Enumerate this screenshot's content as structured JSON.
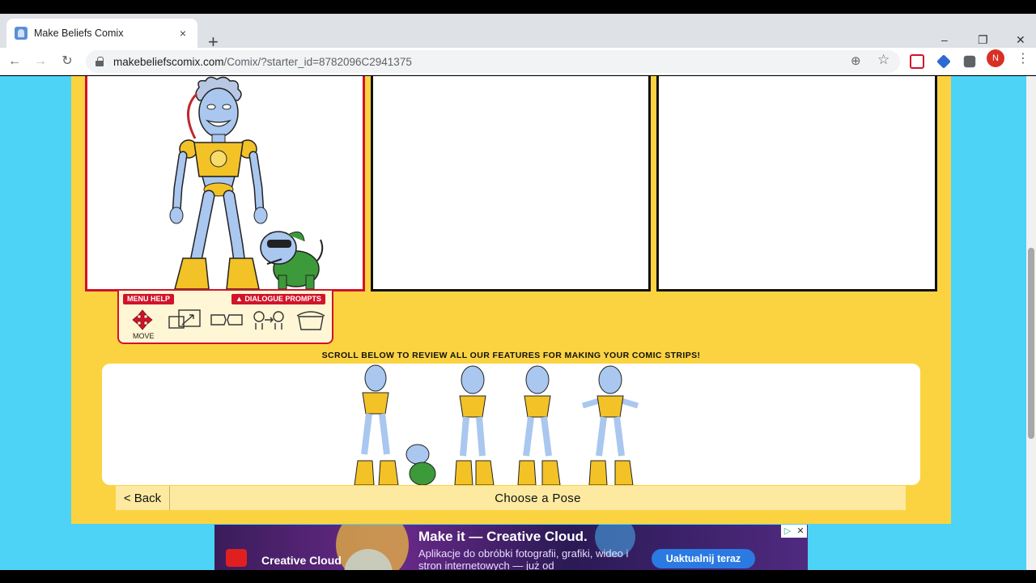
{
  "browser": {
    "tab_title": "Make Beliefs Comix",
    "tab_close": "×",
    "new_tab": "+",
    "window_controls": {
      "minimize": "–",
      "restore": "❐",
      "close": "✕"
    },
    "nav": {
      "back": "←",
      "forward": "→",
      "reload": "↻"
    },
    "url_domain": "makebeliefscomix.com",
    "url_path": "/Comix/?starter_id=8782096C2941375",
    "profile_initial": "N",
    "menu": "⋮",
    "bookmark_star": "☆",
    "add_icon": "⊕"
  },
  "editor": {
    "menu_help": "MENU HELP",
    "dialogue_prompts": "▲ DIALOGUE PROMPTS",
    "move_label": "MOVE",
    "scroll_hint": "SCROLL BELOW TO REVIEW ALL OUR FEATURES FOR MAKING YOUR COMIC STRIPS!",
    "back_button": "< Back",
    "pose_title": "Choose a Pose"
  },
  "ad": {
    "brand": "Creative Cloud",
    "headline": "Make it — Creative Cloud.",
    "subtext": "Aplikacje do obróbki fotografii, grafiki, wideo i stron internetowych — już od",
    "cta": "Uaktualnij teraz",
    "adchoices": "▷",
    "close": "✕"
  },
  "colors": {
    "page_bg": "#4dd3f5",
    "canvas_yellow": "#fbd341",
    "accent_red": "#d2132a",
    "robot_blue": "#a9c7ef",
    "robot_gold": "#f2c227"
  }
}
